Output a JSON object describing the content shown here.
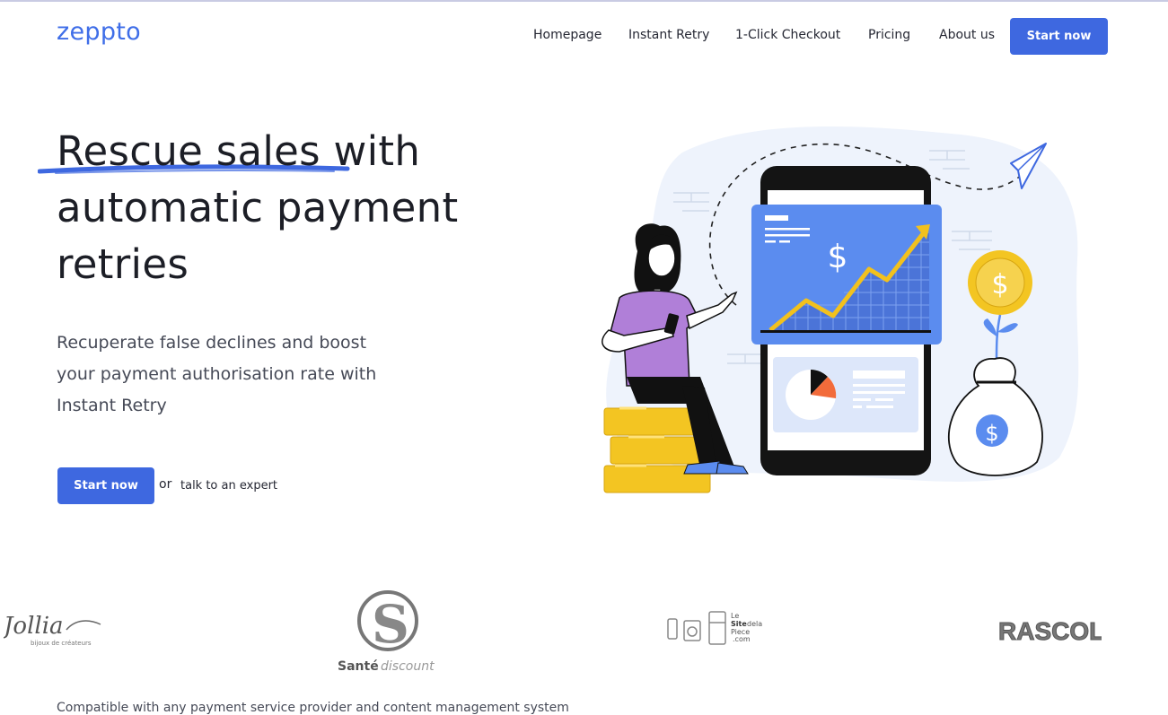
{
  "brand": {
    "name": "zeppto",
    "accent": "#3e68e0"
  },
  "nav": {
    "items": [
      {
        "label": "Homepage"
      },
      {
        "label": "Instant Retry"
      },
      {
        "label": "1-Click Checkout"
      },
      {
        "label": "Pricing"
      },
      {
        "label": "About us"
      }
    ],
    "cta_label": "Start now"
  },
  "hero": {
    "title_lines": [
      "Rescue sales with",
      "automatic payment",
      "retries"
    ],
    "subtitle": "Recuperate false declines and boost your payment authorisation rate with Instant Retry",
    "cta_label": "Start now",
    "or_text": "or",
    "expert_link": "talk to an expert"
  },
  "illustration": {
    "currency_symbol": "$",
    "icon": "payment-growth-illustration"
  },
  "partners": {
    "logos": [
      {
        "name": "Jollia",
        "tagline": "bijoux de créateurs"
      },
      {
        "name": "Santé",
        "name_suffix": "discount"
      },
      {
        "name_parts": [
          "Le",
          "Site",
          "dela",
          "Piece",
          ".com"
        ]
      },
      {
        "name": "RASCOL"
      }
    ]
  },
  "footer_note": "Compatible with any payment service provider and content management system"
}
